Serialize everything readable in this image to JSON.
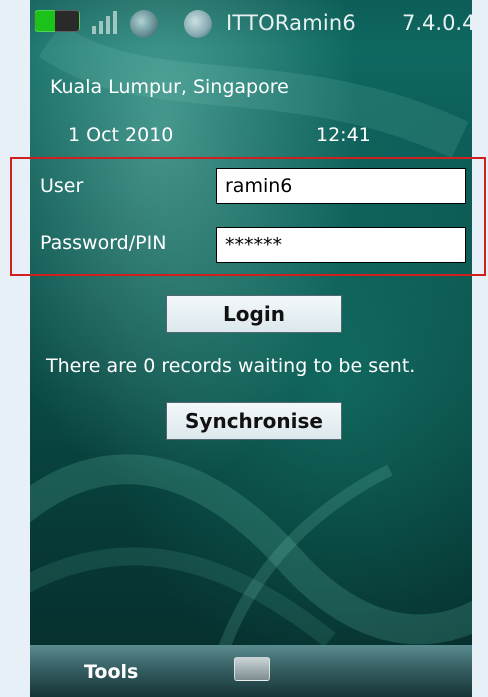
{
  "statusbar": {
    "battery_icon": "battery-icon",
    "signal_icon": "signal-strength-icon",
    "globe_icon": "network-globe-icon",
    "sync_icon": "sync-status-icon",
    "device_name": "ITTORamin6",
    "version": "7.4.0.4"
  },
  "header": {
    "location": "Kuala Lumpur, Singapore",
    "date": "1 Oct 2010",
    "time": "12:41"
  },
  "form": {
    "user_label": "User",
    "user_value": "ramin6",
    "password_label": "Password/PIN",
    "password_value": "******"
  },
  "actions": {
    "login_label": "Login",
    "records_message": "There are 0 records waiting to be sent.",
    "synchronise_label": "Synchronise"
  },
  "bottombar": {
    "tools_label": "Tools",
    "keyboard_icon": "keyboard-icon"
  },
  "colors": {
    "highlight_border": "#d11f1f",
    "background_teal": "#0c5a54"
  }
}
